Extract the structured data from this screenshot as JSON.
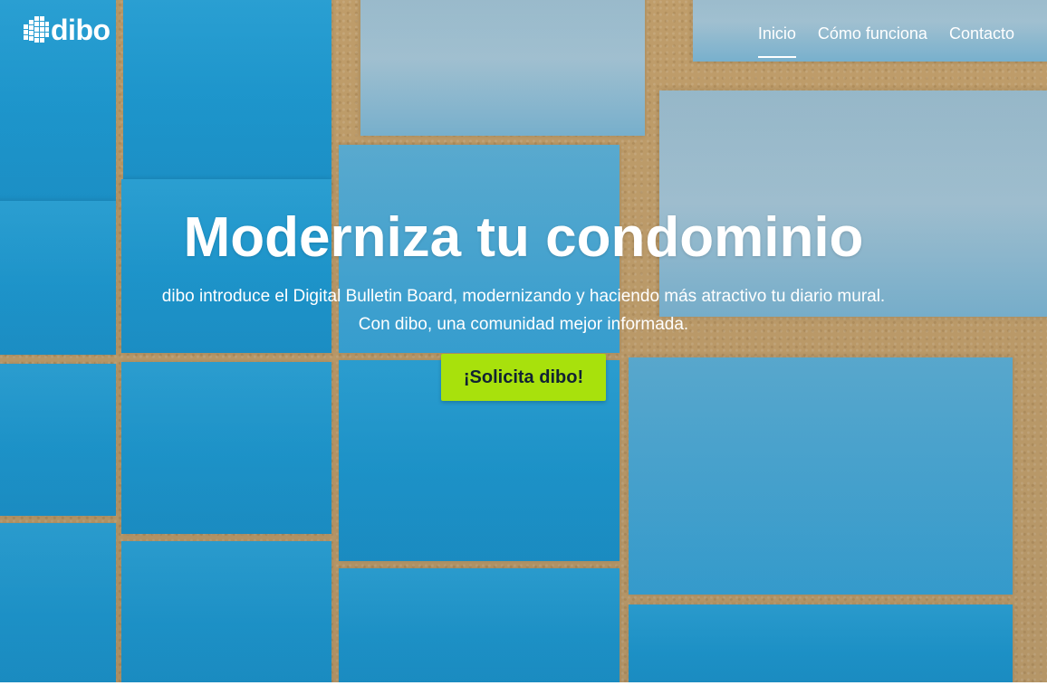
{
  "brand": {
    "name": "dibo",
    "logo_icon": "building-grid-icon"
  },
  "nav": {
    "items": [
      {
        "label": "Inicio",
        "active": true
      },
      {
        "label": "Cómo funciona",
        "active": false
      },
      {
        "label": "Contacto",
        "active": false
      }
    ]
  },
  "hero": {
    "title": "Moderniza tu condominio",
    "subtitle": "dibo introduce el Digital Bulletin Board, modernizando y haciendo más atractivo tu diario mural. Con dibo, una comunidad mejor informada.",
    "cta_label": "¡Solicita dibo!"
  },
  "colors": {
    "cta": "#a8e10c",
    "tile_blue": "#1f9bd2",
    "cork": "#c9a26a",
    "text": "#ffffff"
  }
}
